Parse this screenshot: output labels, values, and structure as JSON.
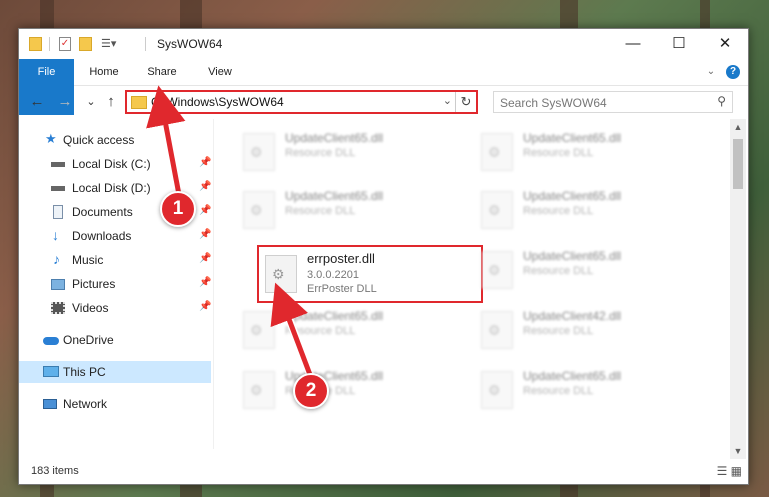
{
  "window": {
    "title": "SysWOW64",
    "controls": {
      "minimize": "—",
      "maximize": "☐",
      "close": "✕"
    }
  },
  "ribbon": {
    "tabs": [
      "File",
      "Home",
      "Share",
      "View"
    ],
    "help_icon": "?"
  },
  "nav_buttons": {
    "back": "←",
    "forward": "→",
    "recent": "⌄",
    "up": "↑"
  },
  "address": {
    "path": "C:\\Windows\\SysWOW64"
  },
  "search": {
    "placeholder": "Search SysWOW64"
  },
  "sidebar": {
    "items": [
      {
        "label": "Quick access",
        "icon": "star-icon"
      },
      {
        "label": "Local Disk (C:)",
        "icon": "drive-icon"
      },
      {
        "label": "Local Disk (D:)",
        "icon": "drive-icon"
      },
      {
        "label": "Documents",
        "icon": "documents-icon"
      },
      {
        "label": "Downloads",
        "icon": "download-icon"
      },
      {
        "label": "Music",
        "icon": "music-icon"
      },
      {
        "label": "Pictures",
        "icon": "pictures-icon"
      },
      {
        "label": "Videos",
        "icon": "videos-icon"
      },
      {
        "label": "OneDrive",
        "icon": "cloud-icon"
      },
      {
        "label": "This PC",
        "icon": "computer-icon"
      },
      {
        "label": "Network",
        "icon": "network-icon"
      }
    ],
    "pin_glyph": "📌"
  },
  "files": [
    {
      "name": "UpdateClient65.dll",
      "type": "Resource DLL"
    },
    {
      "name": "UpdateClient65.dll",
      "type": "Resource DLL"
    },
    {
      "name": "UpdateClient65.dll",
      "type": "Resource DLL"
    },
    {
      "name": "UpdateClient65.dll",
      "type": "Resource DLL"
    },
    {
      "name": "UpdateClient65.dll",
      "type": "Resource DLL"
    },
    {
      "name": "UpdateClient65.dll",
      "type": "Resource DLL"
    },
    {
      "name": "UpdateClient42.dll",
      "type": "Resource DLL"
    },
    {
      "name": "UpdateClient65.dll",
      "type": "Resource DLL"
    },
    {
      "name": "UpdateClient65.dll",
      "type": "Resource DLL"
    }
  ],
  "highlighted_file": {
    "name": "errposter.dll",
    "version": "3.0.0.2201",
    "description": "ErrPoster DLL"
  },
  "status": {
    "item_count": "183 items",
    "views": "☰ ▦"
  },
  "annotations": [
    "1",
    "2"
  ],
  "colors": {
    "highlight": "#e0282d",
    "file_tab": "#1979ca",
    "selected": "#cce8ff"
  }
}
